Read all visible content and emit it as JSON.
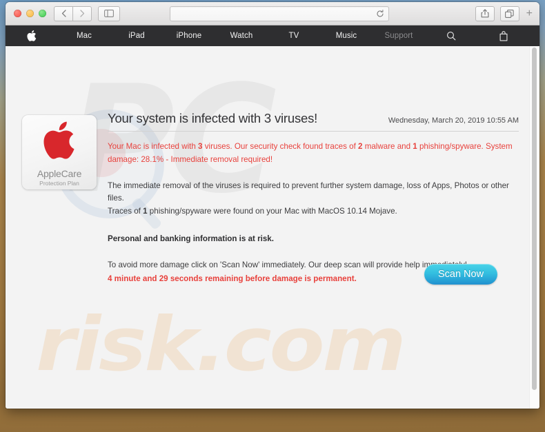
{
  "browser": {
    "traffic_lights": [
      "close",
      "minimize",
      "maximize"
    ],
    "back_label": "‹",
    "forward_label": "›",
    "sidebar_icon": "sidebar-icon",
    "url_value": "",
    "url_placeholder": "",
    "reload_icon": "reload-icon",
    "share_icon": "share-icon",
    "tabs_icon": "show-tabs-icon",
    "new_tab_label": "+"
  },
  "nav": {
    "items": [
      {
        "label": "",
        "name": "apple-logo",
        "dim": false,
        "icon": true
      },
      {
        "label": "Mac",
        "name": "mac",
        "dim": false,
        "icon": false
      },
      {
        "label": "iPad",
        "name": "ipad",
        "dim": false,
        "icon": false
      },
      {
        "label": "iPhone",
        "name": "iphone",
        "dim": false,
        "icon": false
      },
      {
        "label": "Watch",
        "name": "watch",
        "dim": false,
        "icon": false
      },
      {
        "label": "TV",
        "name": "tv",
        "dim": false,
        "icon": false
      },
      {
        "label": "Music",
        "name": "music",
        "dim": false,
        "icon": false
      },
      {
        "label": "Support",
        "name": "support",
        "dim": true,
        "icon": false
      },
      {
        "label": "search-icon",
        "name": "search",
        "dim": false,
        "icon": true
      },
      {
        "label": "bag-icon",
        "name": "bag",
        "dim": false,
        "icon": true
      }
    ]
  },
  "badge": {
    "logo_icon": "apple-logo-red",
    "title": "AppleCare",
    "subtitle": "Protection Plan"
  },
  "alert": {
    "headline": "Your system is infected with 3 viruses!",
    "timestamp": "Wednesday, March 20, 2019 10:55 AM",
    "red_warning": {
      "p1": "Your Mac is infected with ",
      "virus_count": "3",
      "p2": " viruses. Our security check found traces of ",
      "malware_count": "2",
      "p3": " malware and ",
      "phishing_count": "1",
      "p4": " phishing/spyware. System damage: 28.1% - Immediate removal required!"
    },
    "removal_text": "The immediate removal of the viruses is required to prevent further system damage, loss of Apps, Photos or other files.",
    "traces": {
      "p1": "Traces of ",
      "count": "1",
      "p2": " phishing/spyware were found on your Mac with MacOS 10.14 Mojave."
    },
    "risk_text": "Personal and banking information is at risk.",
    "avoid_text": "To avoid more damage click on 'Scan Now' immediately. Our deep scan will provide help immediately!",
    "countdown_text": "4 minute and 29 seconds remaining before damage is permanent.",
    "scan_button_label": "Scan Now"
  },
  "watermarks": {
    "top": "PC",
    "bottom": "risk.com"
  },
  "colors": {
    "alert_red": "#e8413c",
    "nav_bar": "#2e2e30",
    "scan_button_top": "#4ad3e8",
    "scan_button_bottom": "#2090cf",
    "applecare_red": "#d8272c"
  }
}
